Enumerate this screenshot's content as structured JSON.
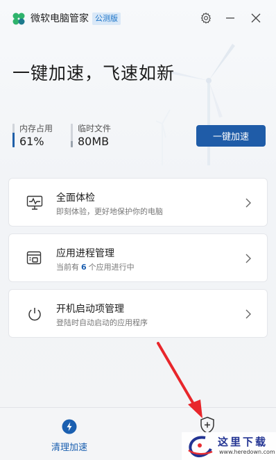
{
  "window": {
    "title": "微软电脑管家",
    "badge": "公测版"
  },
  "hero": {
    "headline": "一键加速，飞速如新"
  },
  "stats": {
    "memory": {
      "label": "内存占用",
      "value": "61%",
      "fraction": 0.61
    },
    "temp_files": {
      "label": "临时文件",
      "value": "80MB",
      "fraction": 0.25
    }
  },
  "primary_action": {
    "label": "一键加速"
  },
  "cards": [
    {
      "title": "全面体检",
      "subtitle": "即刻体验，更好地保护你的电脑",
      "icon": "monitor-pulse-icon"
    },
    {
      "title": "应用进程管理",
      "subtitle_prefix": "当前有",
      "count": "6",
      "subtitle_suffix": "个应用进行中",
      "icon": "app-window-icon"
    },
    {
      "title": "开机启动项管理",
      "subtitle": "登陆时自动启动的应用程序",
      "icon": "power-icon"
    }
  ],
  "bottom_nav": {
    "clean": {
      "label": "清理加速",
      "icon": "lightning-icon"
    },
    "protect": {
      "icon": "shield-plus-icon"
    }
  },
  "watermark": {
    "text": "这里下载",
    "url": "www.heredown.com"
  },
  "colors": {
    "accent": "#1f5ca8",
    "badge_bg": "#d9e8f7",
    "annotation_arrow": "#e8262b"
  }
}
